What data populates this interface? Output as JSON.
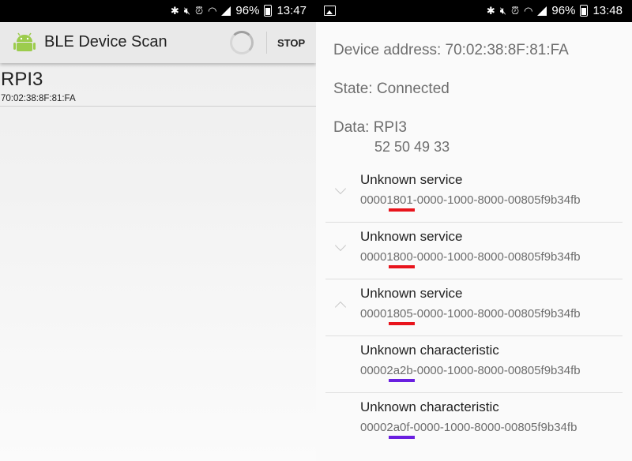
{
  "left": {
    "status_time": "13:47",
    "battery": "96%",
    "app_title": "BLE Device Scan",
    "stop_label": "STOP",
    "device": {
      "name": "RPI3",
      "address": "70:02:38:8F:81:FA"
    }
  },
  "right": {
    "status_time": "13:48",
    "battery": "96%",
    "address_line": "Device address: 70:02:38:8F:81:FA",
    "state_line": "State: Connected",
    "data_line": "Data: RPI3",
    "data_hex": "52 50 49 33",
    "items": [
      {
        "name": "Unknown service",
        "uuid": "00001801-0000-1000-8000-00805f9b34fb",
        "chevron": "down",
        "mark_color": "#e8141c"
      },
      {
        "name": "Unknown service",
        "uuid": "00001800-0000-1000-8000-00805f9b34fb",
        "chevron": "down",
        "mark_color": "#e8141c"
      },
      {
        "name": "Unknown service",
        "uuid": "00001805-0000-1000-8000-00805f9b34fb",
        "chevron": "up",
        "mark_color": "#e8141c"
      },
      {
        "name": "Unknown characteristic",
        "uuid": "00002a2b-0000-1000-8000-00805f9b34fb",
        "chevron": "none",
        "mark_color": "#6a1fe0"
      },
      {
        "name": "Unknown characteristic",
        "uuid": "00002a0f-0000-1000-8000-00805f9b34fb",
        "chevron": "none",
        "mark_color": "#6a1fe0"
      }
    ]
  },
  "icons": {
    "bluetooth": "bluetooth-icon",
    "mute": "mute-icon",
    "alarm": "alarm-icon",
    "wifi": "wifi-icon",
    "signal": "signal-icon",
    "battery": "battery-icon",
    "gallery": "gallery-icon",
    "app": "android-icon"
  }
}
